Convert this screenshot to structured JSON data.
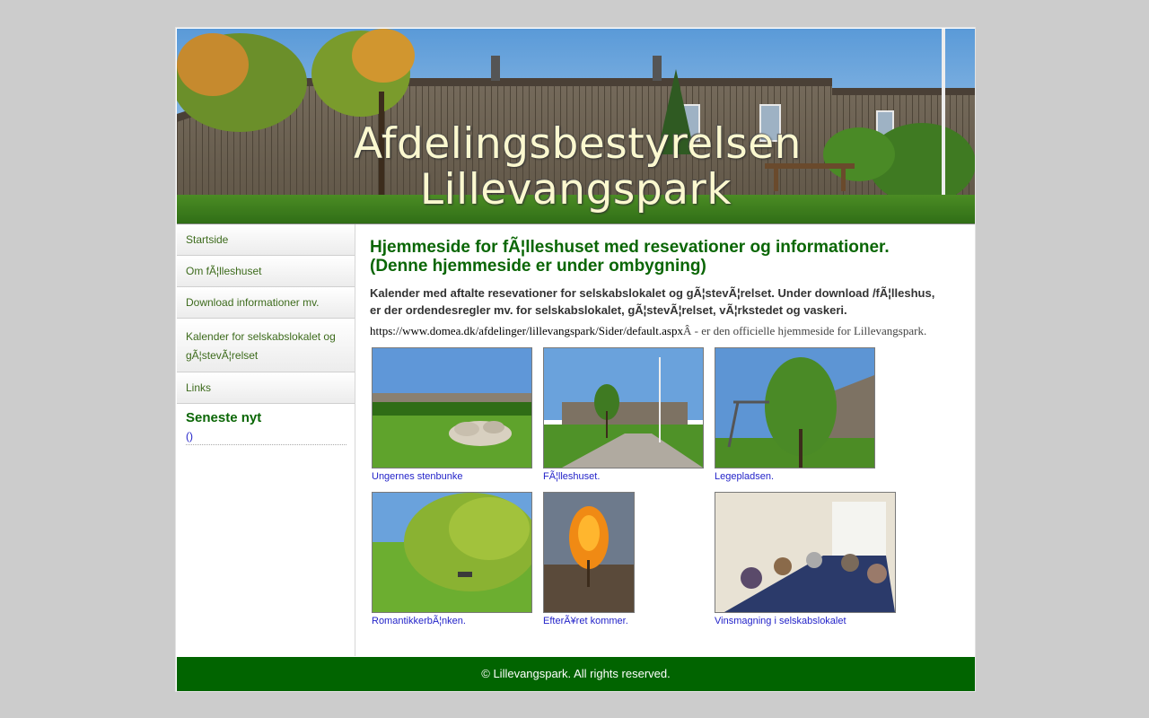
{
  "banner": {
    "line1": "Afdelingsbestyrelsen",
    "line2": "Lillevangspark"
  },
  "sidebar": {
    "items": [
      {
        "label": "Startside"
      },
      {
        "label": "Om fÃ¦lleshuset"
      },
      {
        "label": "Download informationer mv."
      },
      {
        "label": "Kalender for selskabslokalet og gÃ¦stevÃ¦relset"
      },
      {
        "label": "Links"
      }
    ],
    "news_heading": "Seneste nyt",
    "news_link": "()"
  },
  "main": {
    "title_line1": "Hjemmeside for fÃ¦lleshuset med resevationer og informationer.",
    "title_line2": "(Denne hjemmeside er under ombygning)",
    "intro": "Kalender med aftalte resevationer for selskabslokalet og gÃ¦stevÃ¦relset. Under download /fÃ¦lleshus, er der ordendesregler mv. for selskabslokalet, gÃ¦stevÃ¦relset, vÃ¦rkstedet og vaskeri.",
    "url": "https://www.domea.dk/afdelinger/lillevangspark/Sider/default.aspx",
    "url_suffix": "Â - er den officielle hjemmeside for Lillevangspark.",
    "gallery": [
      {
        "caption": "Ungernes stenbunke"
      },
      {
        "caption": "FÃ¦lleshuset."
      },
      {
        "caption": "Legepladsen."
      },
      {
        "caption": "RomantikkerbÃ¦nken."
      },
      {
        "caption": "EfterÃ¥ret kommer."
      },
      {
        "caption": "Vinsmagning i selskabslokalet"
      }
    ]
  },
  "footer": {
    "text": "© Lillevangspark. All rights reserved."
  },
  "colors": {
    "page_background": "#cccccc",
    "heading_green": "#0a6605",
    "footer_green": "#016400",
    "link_blue": "#2323c9",
    "nav_text": "#3d6b1c"
  }
}
